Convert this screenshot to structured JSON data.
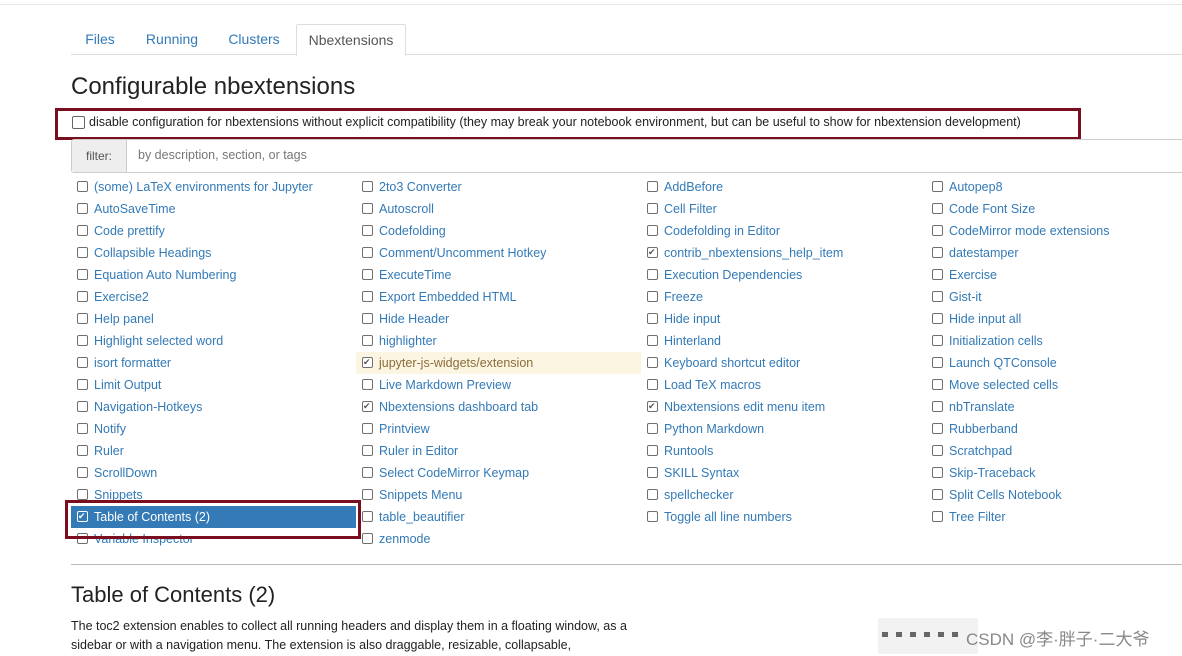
{
  "tabs": [
    {
      "label": "Files",
      "active": false
    },
    {
      "label": "Running",
      "active": false
    },
    {
      "label": "Clusters",
      "active": false
    },
    {
      "label": "Nbextensions",
      "active": true
    }
  ],
  "page_title": "Configurable nbextensions",
  "compat_option": {
    "checked": false,
    "label": "disable configuration for nbextensions without explicit compatibility (they may break your notebook environment, but can be useful to show for nbextension development)"
  },
  "filter": {
    "label": "filter:",
    "placeholder": "by description, section, or tags",
    "value": ""
  },
  "extension_columns": [
    [
      {
        "label": "(some) LaTeX environments for Jupyter",
        "checked": false
      },
      {
        "label": "AutoSaveTime",
        "checked": false
      },
      {
        "label": "Code prettify",
        "checked": false
      },
      {
        "label": "Collapsible Headings",
        "checked": false
      },
      {
        "label": "Equation Auto Numbering",
        "checked": false
      },
      {
        "label": "Exercise2",
        "checked": false
      },
      {
        "label": "Help panel",
        "checked": false
      },
      {
        "label": "Highlight selected word",
        "checked": false
      },
      {
        "label": "isort formatter",
        "checked": false
      },
      {
        "label": "Limit Output",
        "checked": false
      },
      {
        "label": "Navigation-Hotkeys",
        "checked": false
      },
      {
        "label": "Notify",
        "checked": false
      },
      {
        "label": "Ruler",
        "checked": false
      },
      {
        "label": "ScrollDown",
        "checked": false
      },
      {
        "label": "Snippets",
        "checked": false
      },
      {
        "label": "Table of Contents (2)",
        "checked": true,
        "selected": true
      },
      {
        "label": "Variable Inspector",
        "checked": false
      }
    ],
    [
      {
        "label": "2to3 Converter",
        "checked": false
      },
      {
        "label": "Autoscroll",
        "checked": false
      },
      {
        "label": "Codefolding",
        "checked": false
      },
      {
        "label": "Comment/Uncomment Hotkey",
        "checked": false
      },
      {
        "label": "ExecuteTime",
        "checked": false
      },
      {
        "label": "Export Embedded HTML",
        "checked": false
      },
      {
        "label": "Hide Header",
        "checked": false
      },
      {
        "label": "highlighter",
        "checked": false
      },
      {
        "label": "jupyter-js-widgets/extension",
        "checked": true,
        "warning": true
      },
      {
        "label": "Live Markdown Preview",
        "checked": false
      },
      {
        "label": "Nbextensions dashboard tab",
        "checked": true
      },
      {
        "label": "Printview",
        "checked": false
      },
      {
        "label": "Ruler in Editor",
        "checked": false
      },
      {
        "label": "Select CodeMirror Keymap",
        "checked": false
      },
      {
        "label": "Snippets Menu",
        "checked": false
      },
      {
        "label": "table_beautifier",
        "checked": false
      },
      {
        "label": "zenmode",
        "checked": false
      }
    ],
    [
      {
        "label": "AddBefore",
        "checked": false
      },
      {
        "label": "Cell Filter",
        "checked": false
      },
      {
        "label": "Codefolding in Editor",
        "checked": false
      },
      {
        "label": "contrib_nbextensions_help_item",
        "checked": true
      },
      {
        "label": "Execution Dependencies",
        "checked": false
      },
      {
        "label": "Freeze",
        "checked": false
      },
      {
        "label": "Hide input",
        "checked": false
      },
      {
        "label": "Hinterland",
        "checked": false
      },
      {
        "label": "Keyboard shortcut editor",
        "checked": false
      },
      {
        "label": "Load TeX macros",
        "checked": false
      },
      {
        "label": "Nbextensions edit menu item",
        "checked": true
      },
      {
        "label": "Python Markdown",
        "checked": false
      },
      {
        "label": "Runtools",
        "checked": false
      },
      {
        "label": "SKILL Syntax",
        "checked": false
      },
      {
        "label": "spellchecker",
        "checked": false
      },
      {
        "label": "Toggle all line numbers",
        "checked": false
      }
    ],
    [
      {
        "label": "Autopep8",
        "checked": false
      },
      {
        "label": "Code Font Size",
        "checked": false
      },
      {
        "label": "CodeMirror mode extensions",
        "checked": false
      },
      {
        "label": "datestamper",
        "checked": false
      },
      {
        "label": "Exercise",
        "checked": false
      },
      {
        "label": "Gist-it",
        "checked": false
      },
      {
        "label": "Hide input all",
        "checked": false
      },
      {
        "label": "Initialization cells",
        "checked": false
      },
      {
        "label": "Launch QTConsole",
        "checked": false
      },
      {
        "label": "Move selected cells",
        "checked": false
      },
      {
        "label": "nbTranslate",
        "checked": false
      },
      {
        "label": "Rubberband",
        "checked": false
      },
      {
        "label": "Scratchpad",
        "checked": false
      },
      {
        "label": "Skip-Traceback",
        "checked": false
      },
      {
        "label": "Split Cells Notebook",
        "checked": false
      },
      {
        "label": "Tree Filter",
        "checked": false
      }
    ]
  ],
  "details": {
    "title": "Table of Contents (2)",
    "description": "The toc2 extension enables to collect all running headers and display them in a floating window, as a sidebar or with a navigation menu. The extension is also draggable, resizable, collapsable,"
  },
  "watermark": "CSDN @李·胖子·二大爷",
  "colors": {
    "link": "#337ab7",
    "selected_bg": "#337ab7",
    "warning_bg": "#fcf5e1",
    "annotation_border": "#7a0e1e"
  }
}
